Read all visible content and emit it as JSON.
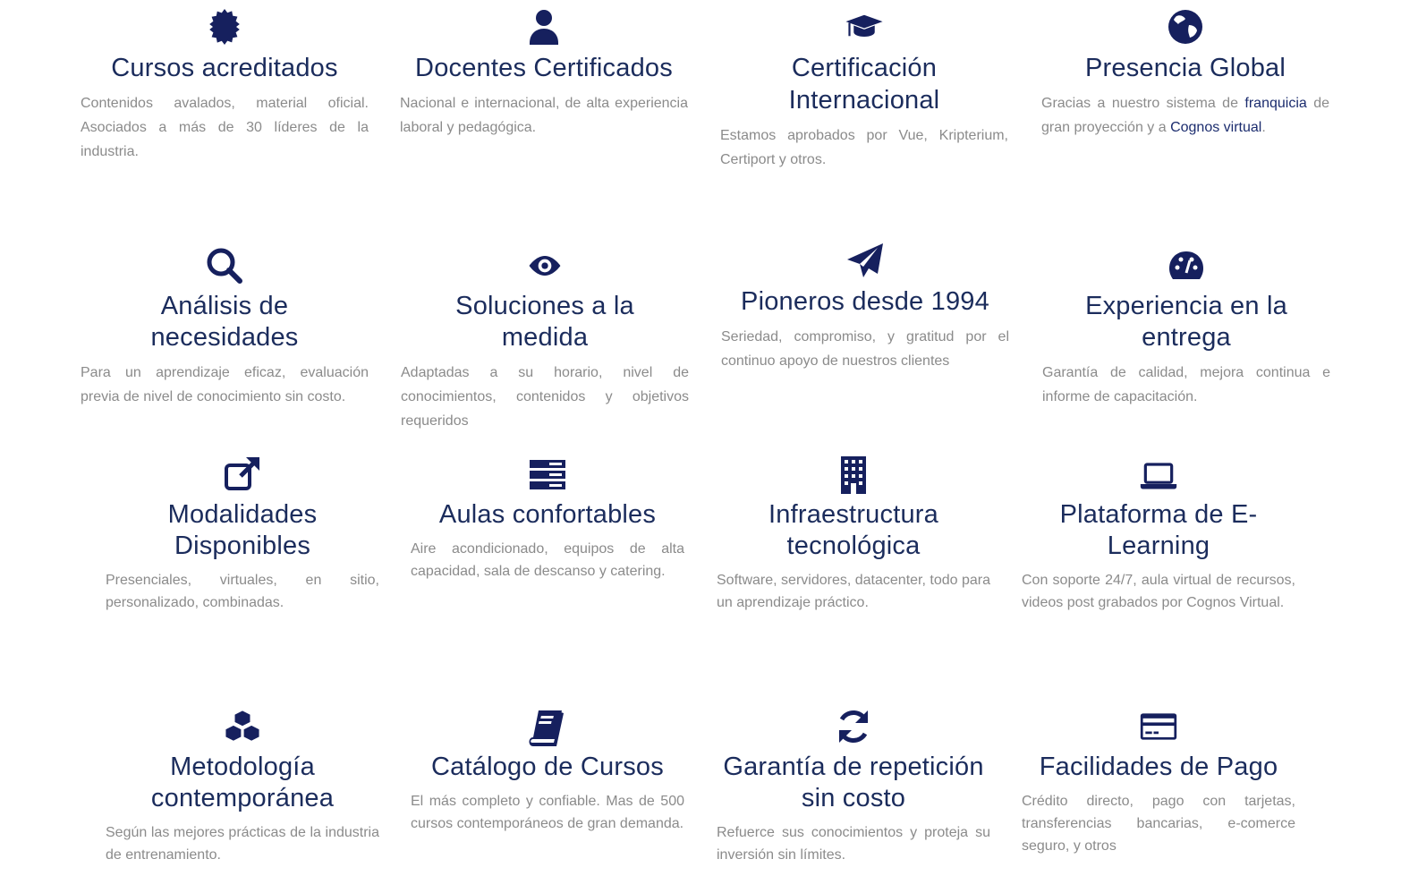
{
  "colors": {
    "icon": "#16205e",
    "title": "#1b2c5c",
    "text": "#8b8b8b",
    "link": "#1b2c6e"
  },
  "features": [
    {
      "icon": "seal-icon",
      "title": "Cursos acreditados",
      "desc": "Contenidos avalados, material oficial. Asociados a más de 30 líderes de la industria."
    },
    {
      "icon": "user-icon",
      "title": "Docentes Certificados",
      "desc": "Nacional e internacional, de alta experiencia laboral y pedagógica."
    },
    {
      "icon": "graduation-cap-icon",
      "title": "Certificación Internacional",
      "desc": "Estamos aprobados por Vue, Kripterium, Certiport y otros."
    },
    {
      "icon": "globe-icon",
      "title": "Presencia Global",
      "desc_pre": "Gracias a nuestro sistema de ",
      "link1": "franquicia",
      "desc_mid": " de gran proyección y a ",
      "link2": "Cognos virtual",
      "desc_post": "."
    },
    {
      "icon": "search-icon",
      "title": "Análisis de necesidades",
      "desc": "Para un aprendizaje eficaz, evaluación previa de nivel de conocimiento sin costo."
    },
    {
      "icon": "eye-icon",
      "title": "Soluciones a la medida",
      "desc": "Adaptadas a su horario, nivel de conocimientos, contenidos y objetivos requeridos"
    },
    {
      "icon": "paper-plane-icon",
      "title": "Pioneros desde 1994",
      "desc": "Seriedad, compromiso, y gratitud por el continuo apoyo de nuestros clientes"
    },
    {
      "icon": "dashboard-icon",
      "title": "Experiencia en la entrega",
      "desc": "Garantía de calidad, mejora continua e informe de capacitación."
    },
    {
      "icon": "external-link-icon",
      "title": "Modalidades Disponibles",
      "desc": "Presenciales, virtuales, en sitio, personalizado, combinadas."
    },
    {
      "icon": "server-icon",
      "title": "Aulas confortables",
      "desc": "Aire acondicionado, equipos de alta capacidad, sala de descanso y catering."
    },
    {
      "icon": "building-icon",
      "title": "Infraestructura tecnológica",
      "desc": "Software, servidores, datacenter, todo para un aprendizaje práctico."
    },
    {
      "icon": "laptop-icon",
      "title": "Plataforma de E-Learning",
      "desc": "Con soporte 24/7, aula virtual de recursos, videos post grabados por Cognos Virtual."
    },
    {
      "icon": "cubes-icon",
      "title": "Metodología contemporánea",
      "desc": "Según las mejores prácticas de la industria de entrenamiento."
    },
    {
      "icon": "book-icon",
      "title": "Catálogo de Cursos",
      "desc": "El más completo y confiable. Mas de 500 cursos contemporáneos de gran demanda."
    },
    {
      "icon": "refresh-icon",
      "title": "Garantía de repetición sin costo",
      "desc": "Refuerce sus conocimientos y proteja su inversión sin límites."
    },
    {
      "icon": "credit-card-icon",
      "title": "Facilidades de Pago",
      "desc": "Crédito directo, pago con tarjetas, transferencias bancarias, e-comerce seguro, y otros"
    }
  ]
}
